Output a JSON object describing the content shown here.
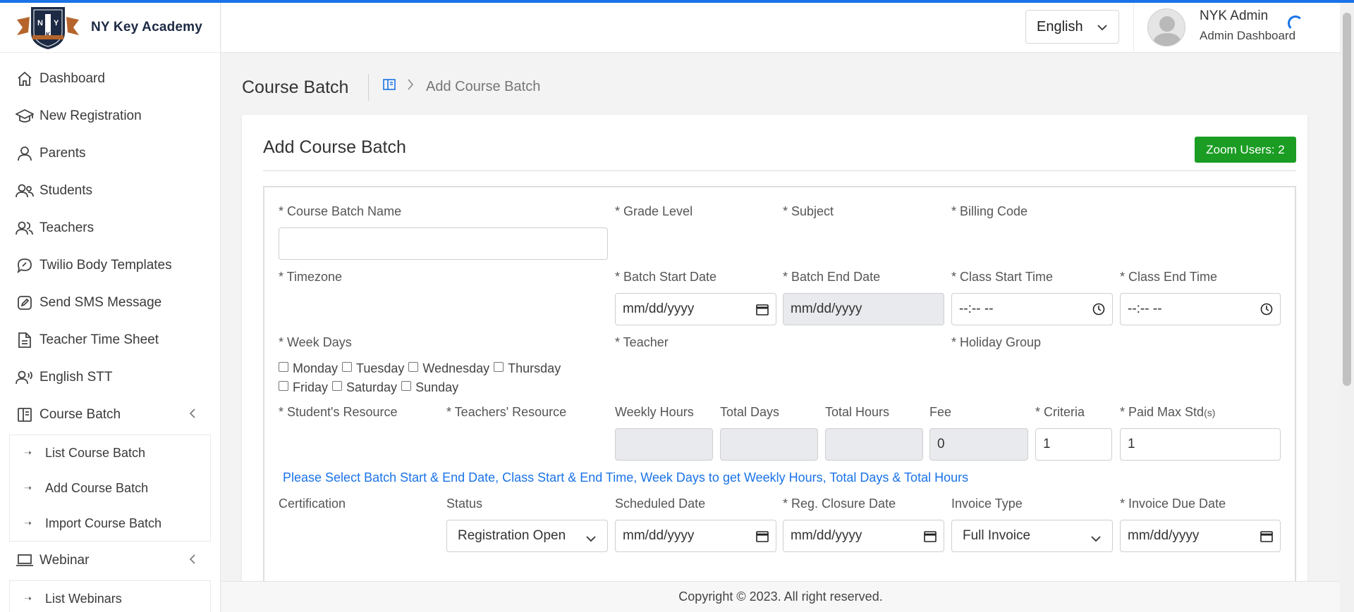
{
  "app": {
    "name": "NY Key Academy",
    "logo_letters": "N Y K"
  },
  "sidebar": {
    "items": [
      {
        "label": "Dashboard",
        "icon": "home-icon"
      },
      {
        "label": "New Registration",
        "icon": "graduation-cap-icon"
      },
      {
        "label": "Parents",
        "icon": "user-icon"
      },
      {
        "label": "Students",
        "icon": "users-icon"
      },
      {
        "label": "Teachers",
        "icon": "people-icon"
      },
      {
        "label": "Twilio Body Templates",
        "icon": "chat-bubble-icon"
      },
      {
        "label": "Send SMS Message",
        "icon": "edit-icon"
      },
      {
        "label": "Teacher Time Sheet",
        "icon": "document-icon"
      },
      {
        "label": "English STT",
        "icon": "voice-icon"
      },
      {
        "label": "Course Batch",
        "icon": "book-icon"
      },
      {
        "label": "Webinar",
        "icon": "laptop-icon"
      }
    ],
    "course_batch_sub": [
      "List Course Batch",
      "Add Course Batch",
      "Import Course Batch"
    ],
    "webinar_sub": [
      "List Webinars"
    ]
  },
  "header": {
    "language": "English",
    "user_name": "NYK Admin",
    "user_role": "Admin Dashboard"
  },
  "page": {
    "title": "Course Batch",
    "breadcrumb_current": "Add Course Batch"
  },
  "card": {
    "title": "Add Course Batch",
    "zoom_badge": "Zoom Users: 2"
  },
  "form": {
    "labels": {
      "course_batch_name": "* Course Batch Name",
      "grade_level": "* Grade Level",
      "subject": "* Subject",
      "billing_code": "* Billing Code",
      "timezone": "* Timezone",
      "batch_start_date": "* Batch Start Date",
      "batch_end_date": "* Batch End Date",
      "class_start_time": "* Class Start Time",
      "class_end_time": "* Class End Time",
      "week_days": "* Week Days",
      "teacher": "* Teacher",
      "holiday_group": "* Holiday Group",
      "students_resource": "* Student's Resource",
      "teachers_resource": "* Teachers' Resource",
      "weekly_hours": "Weekly Hours",
      "total_days": "Total Days",
      "total_hours": "Total Hours",
      "fee": "Fee",
      "criteria": "* Criteria",
      "paid_max_std": "* Paid Max Std",
      "paid_max_std_suffix": "(s)",
      "certification": "Certification",
      "status": "Status",
      "scheduled_date": "Scheduled Date",
      "reg_closure_date": "* Reg. Closure Date",
      "invoice_type": "Invoice Type",
      "invoice_due_date": "* Invoice Due Date"
    },
    "values": {
      "course_batch_name": "",
      "date_placeholder": "mm/dd/yyyy",
      "time_placeholder": "--:-- --",
      "fee": "0",
      "criteria": "1",
      "paid_max_std": "1",
      "status": "Registration Open",
      "invoice_type": "Full Invoice"
    },
    "weekdays": [
      "Monday",
      "Tuesday",
      "Wednesday",
      "Thursday",
      "Friday",
      "Saturday",
      "Sunday"
    ],
    "hint": "Please Select Batch Start & End Date, Class Start & End Time, Week Days to get Weekly Hours, Total Days & Total Hours"
  },
  "footer": {
    "text": "Copyright © 2023. All right reserved."
  },
  "colors": {
    "accent": "#1a73e8",
    "badge_green": "#1b9d23",
    "disabled_bg": "#e8eaed"
  }
}
